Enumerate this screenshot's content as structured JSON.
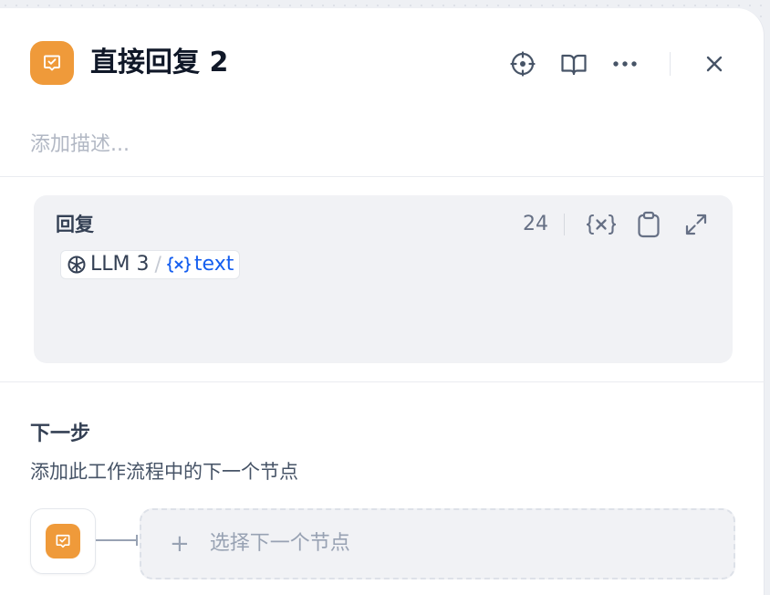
{
  "header": {
    "title": "直接回复 2",
    "description_placeholder": "添加描述...",
    "node_color": "#ef9a3a",
    "actions": [
      {
        "icon": "crosshair-icon"
      },
      {
        "icon": "book-open-icon"
      },
      {
        "icon": "more-horizontal-icon"
      },
      {
        "icon": "close-icon"
      }
    ]
  },
  "reply": {
    "label": "回复",
    "char_count": "24",
    "var_insert_icon": "variable-icon",
    "copy_icon": "clipboard-icon",
    "expand_icon": "expand-icon",
    "variable": {
      "node_icon": "llm-node-icon",
      "node_name": "LLM 3",
      "separator": "/",
      "var_icon": "{x}",
      "var_name": "text",
      "var_color": "#155eef"
    }
  },
  "next_step": {
    "title": "下一步",
    "description": "添加此工作流程中的下一个节点",
    "plus": "+",
    "select_label": "选择下一个节点"
  }
}
